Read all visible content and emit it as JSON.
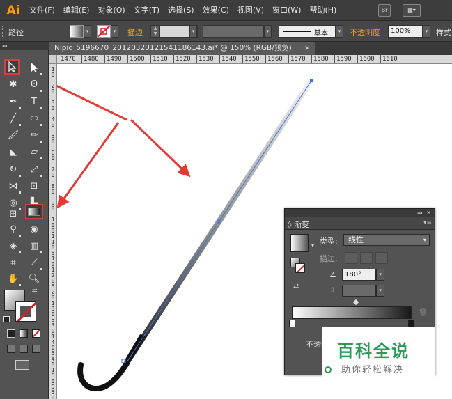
{
  "app": {
    "logo": "Ai"
  },
  "menus": [
    "文件(F)",
    "编辑(E)",
    "对象(O)",
    "文字(T)",
    "选择(S)",
    "效果(C)",
    "视图(V)",
    "窗口(W)",
    "帮助(H)"
  ],
  "menubar_icons": {
    "bridge": "Br",
    "arrange": "arrange-icon"
  },
  "control_bar": {
    "selection_type": "路径",
    "stroke_label": "描边",
    "stroke_profile": "基本",
    "opacity_label": "不透明度",
    "opacity_value": "100%",
    "style_label": "样式"
  },
  "document_tab": {
    "title": "Nipic_5196670_20120320121541186143.ai* @ 150% (RGB/预览)",
    "close": "×"
  },
  "ruler": {
    "horizontal": [
      "1470",
      "1480",
      "1490",
      "1500",
      "1510",
      "1520",
      "1530",
      "1540",
      "1550",
      "1560",
      "1570",
      "1580",
      "1590",
      "1600",
      "1610"
    ],
    "vertical": [
      "1\n0",
      "2\n0",
      "3\n0",
      "4\n0",
      "5\n0",
      "6\n0",
      "7\n0",
      "8\n0",
      "9\n0",
      "1\n0\n0",
      "1\n1\n0",
      "5\n1\n0",
      "1\n2\n0",
      "5\n2\n0",
      "1\n3\n0",
      "5\n3\n0",
      "1\n4\n0",
      "5\n4\n0",
      "1\n5\n0",
      "5\n5\n0"
    ]
  },
  "gradient_panel": {
    "title": "渐变",
    "type_label": "类型:",
    "type_value": "线性",
    "stroke_label": "描边:",
    "angle_value": "180°",
    "opacity_label": "不透明",
    "start_color": "#fdfdfd",
    "end_color": "#181818"
  },
  "colors": {
    "annotation_arrow": "#e53935",
    "selection_path": "#4a6fd6",
    "stroke_red": "#d62020"
  },
  "watermark": {
    "title": "百科全说",
    "subtitle": "助你轻松解决"
  }
}
